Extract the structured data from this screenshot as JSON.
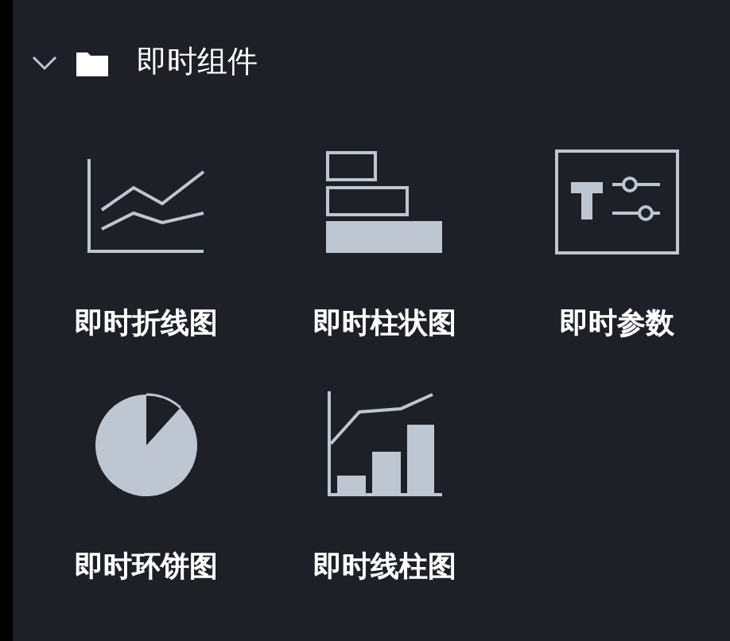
{
  "group": {
    "title": "即时组件",
    "expanded": true,
    "items": [
      {
        "label": "即时折线图",
        "kind": "line"
      },
      {
        "label": "即时柱状图",
        "kind": "bar"
      },
      {
        "label": "即时参数",
        "kind": "param"
      },
      {
        "label": "即时环饼图",
        "kind": "pie"
      },
      {
        "label": "即时线柱图",
        "kind": "linebar"
      }
    ]
  }
}
